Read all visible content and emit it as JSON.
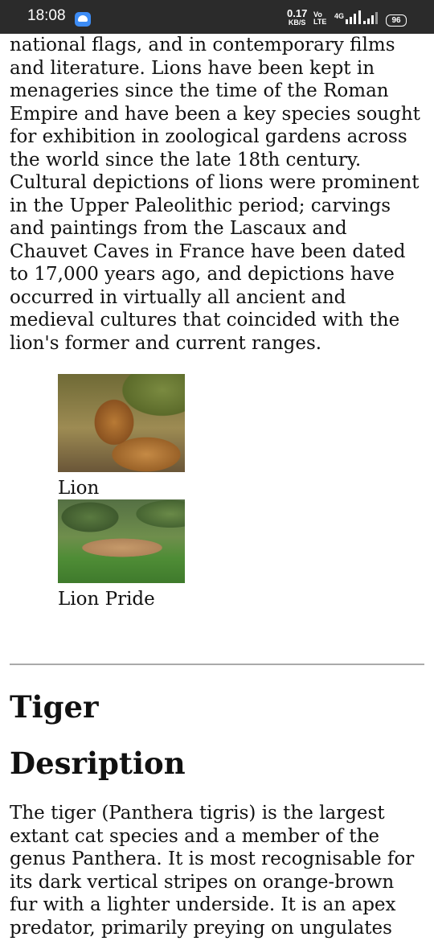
{
  "status_bar": {
    "time": "18:08",
    "speed_value": "0.17",
    "speed_unit": "KB/S",
    "volte_top": "Vo",
    "volte_bottom": "LTE",
    "network": "4G",
    "battery": "96"
  },
  "article": {
    "lion_paragraph": "national flags, and in contemporary films and literature. Lions have been kept in menageries since the time of the Roman Empire and have been a key species sought for exhibition in zoological gardens across the world since the late 18th century. Cultural depictions of lions were prominent in the Upper Paleolithic period; carvings and paintings from the Lascaux and Chauvet Caves in France have been dated to 17,000 years ago, and depictions have occurred in virtually all ancient and medieval cultures that coincided with the lion's former and current ranges.",
    "figures": [
      {
        "caption": "Lion"
      },
      {
        "caption": "Lion Pride"
      }
    ],
    "tiger_heading": "Tiger",
    "description_heading": "Desription",
    "tiger_paragraph": "The tiger (Panthera tigris) is the largest extant cat species and a member of the genus Panthera. It is most recognisable for its dark vertical stripes on orange-brown fur with a lighter underside. It is an apex predator, primarily preying on ungulates"
  }
}
